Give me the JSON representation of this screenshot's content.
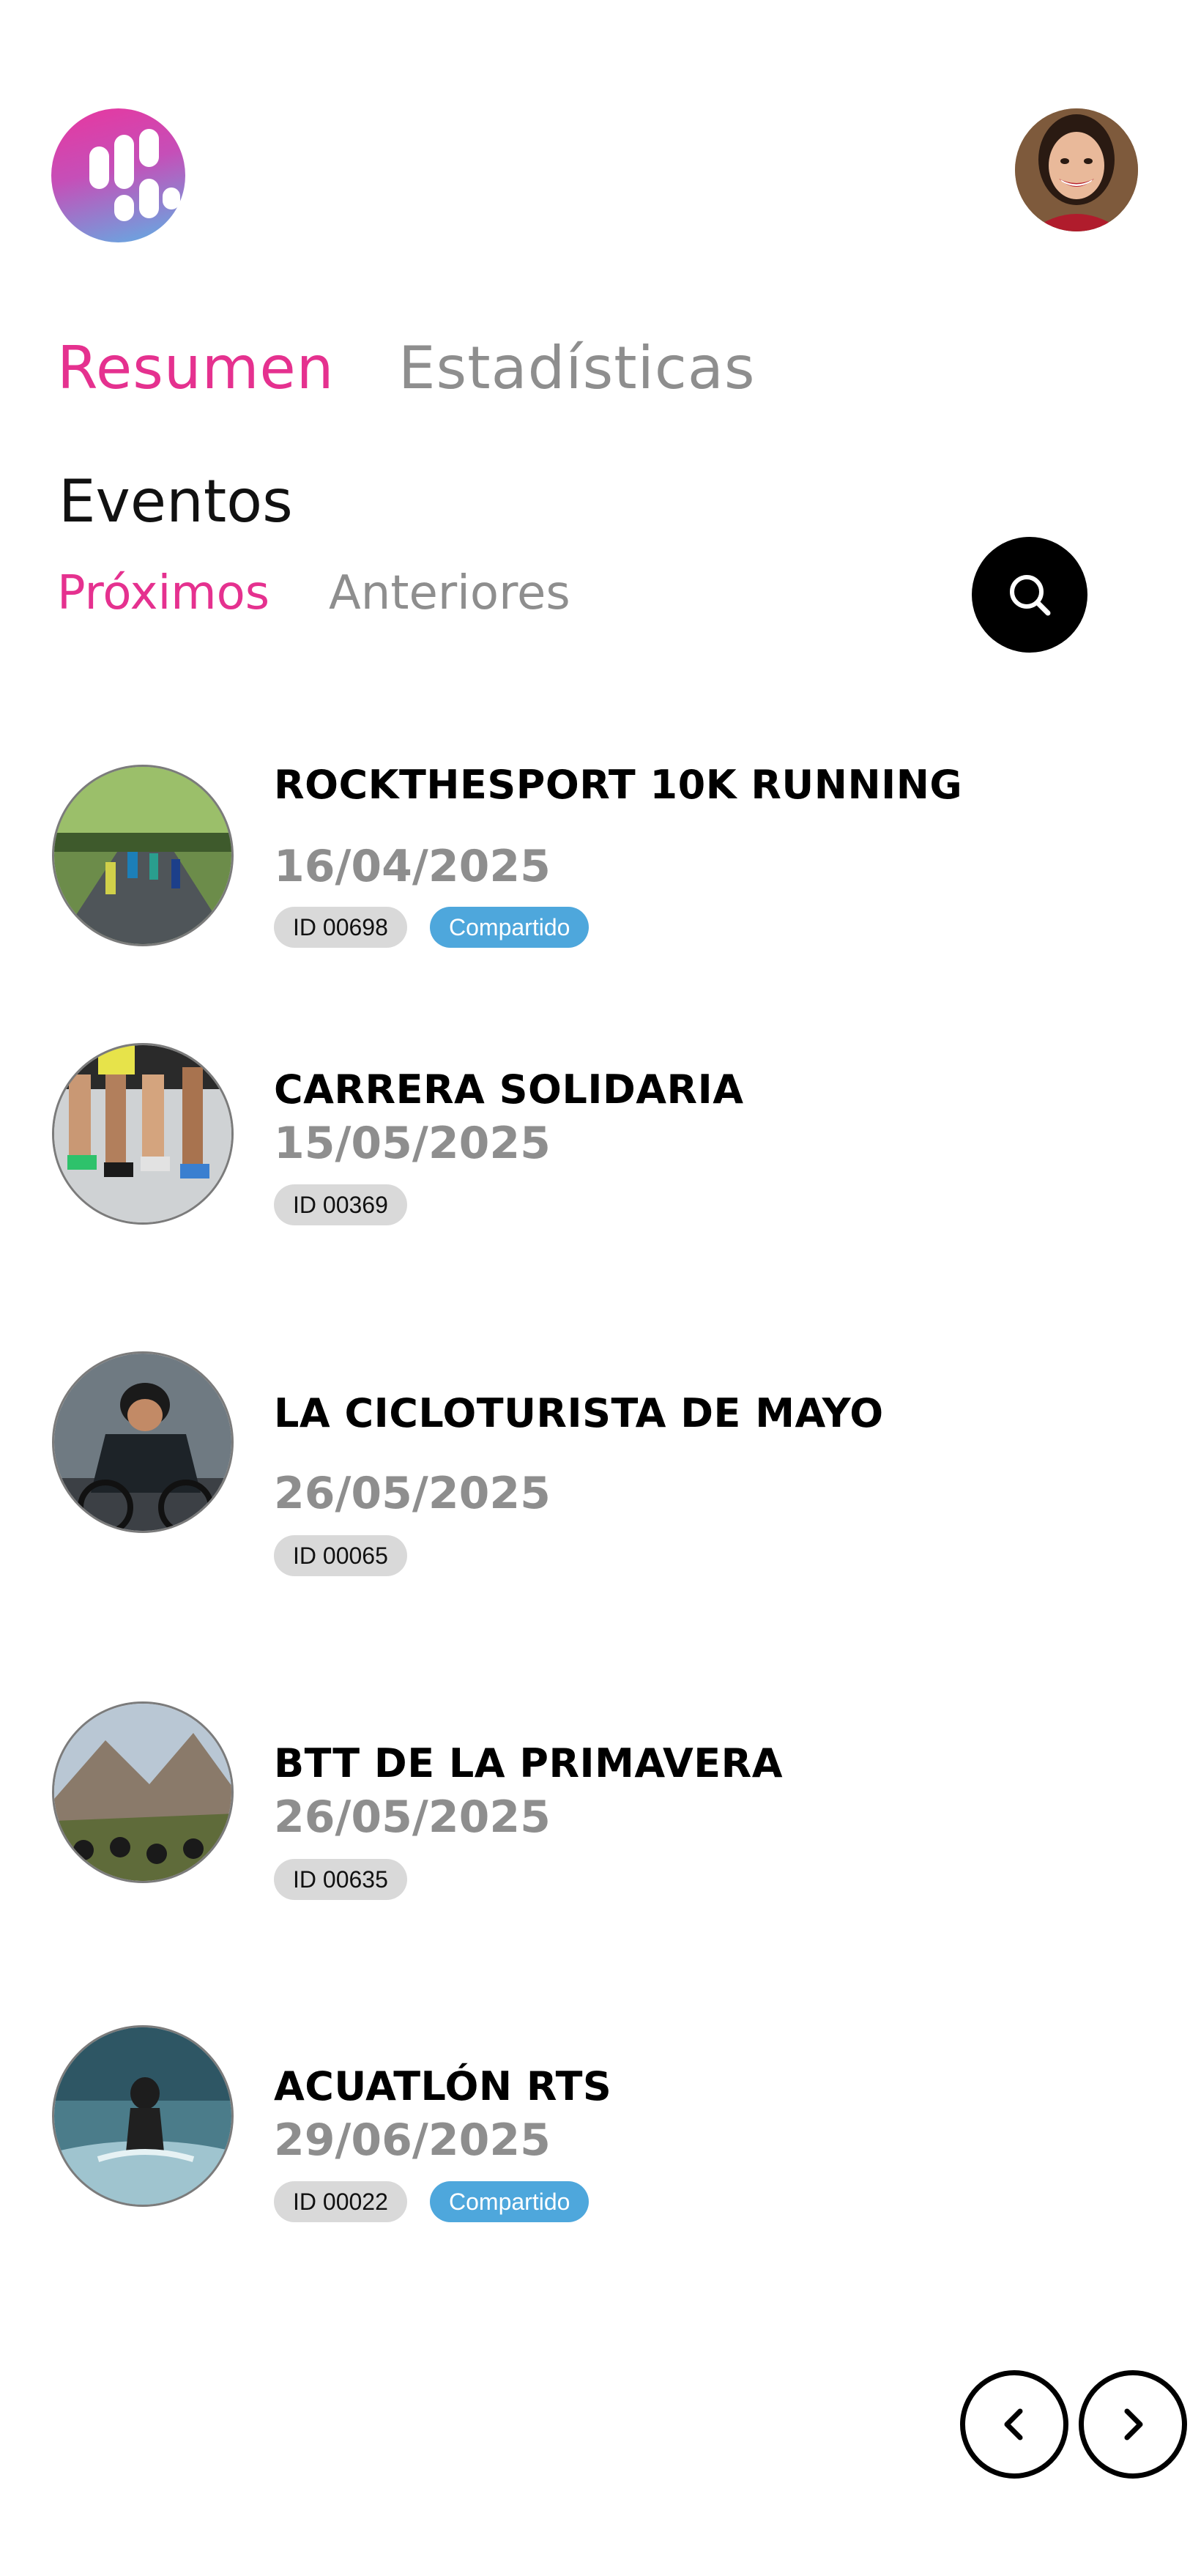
{
  "header": {
    "logo_icon": "bars-logo-icon",
    "avatar_icon": "user-avatar"
  },
  "main_tabs": [
    {
      "label": "Resumen",
      "active": true
    },
    {
      "label": "Estadísticas",
      "active": false
    }
  ],
  "section": {
    "title": "Eventos",
    "sub_tabs": [
      {
        "label": "Próximos",
        "active": true
      },
      {
        "label": "Anteriores",
        "active": false
      }
    ],
    "search_icon": "search-icon"
  },
  "events": [
    {
      "title": "ROCKTHESPORT 10K RUNNING",
      "date": "16/04/2025",
      "id": "ID 00698",
      "shared": "Compartido",
      "image": "running-crowd-photo"
    },
    {
      "title": "CARRERA SOLIDARIA",
      "date": "15/05/2025",
      "id": "ID 00369",
      "image": "runners-legs-photo"
    },
    {
      "title": "LA CICLOTURISTA DE MAYO",
      "date": "26/05/2025",
      "id": "ID 00065",
      "image": "cyclist-photo"
    },
    {
      "title": "BTT DE LA PRIMAVERA",
      "date": "26/05/2025",
      "id": "ID 00635",
      "image": "mountain-bikers-photo"
    },
    {
      "title": "ACUATLÓN RTS",
      "date": "29/06/2025",
      "id": "ID 00022",
      "shared": "Compartido",
      "image": "water-runner-photo"
    }
  ],
  "pager": {
    "prev_icon": "chevron-left-icon",
    "next_icon": "chevron-right-icon"
  },
  "colors": {
    "accent": "#e5318f",
    "muted": "#8e8e8e",
    "shared_badge": "#4ea7dc",
    "id_badge": "#d9d9d9"
  }
}
